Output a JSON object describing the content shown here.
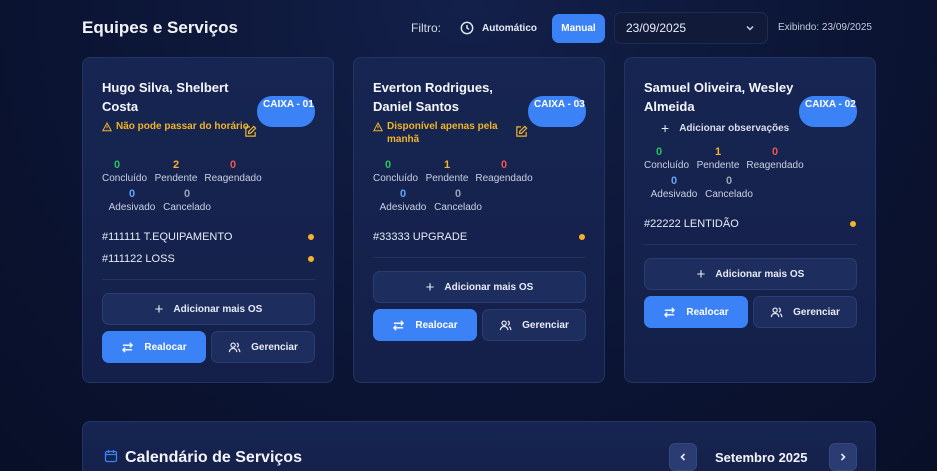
{
  "header": {
    "title": "Equipes e Serviços",
    "filter_label": "Filtro:",
    "auto_label": "Automático",
    "manual_label": "Manual",
    "date_value": "23/09/2025",
    "showing_text": "Exibindo: 23/09/2025"
  },
  "status_labels": {
    "concluido": "Concluído",
    "pendente": "Pendente",
    "reagendado": "Reagendado",
    "adesivado": "Adesivado",
    "cancelado": "Cancelado"
  },
  "actions": {
    "add_os": "Adicionar mais OS",
    "realocar": "Realocar",
    "gerenciar": "Gerenciar",
    "add_obs": "Adicionar observações"
  },
  "teams": [
    {
      "names": "Hugo Silva, Shelbert Costa",
      "badge": "CAIXA - 01",
      "note": "Não pode passar do horário",
      "stats": {
        "concluido": "0",
        "pendente": "2",
        "reagendado": "0",
        "adesivado": "0",
        "cancelado": "0"
      },
      "orders": [
        "#111111 T.EQUIPAMENTO",
        "#111122 LOSS"
      ]
    },
    {
      "names": "Everton Rodrigues, Daniel Santos",
      "badge": "CAIXA - 03",
      "note": "Disponível apenas pela manhã",
      "stats": {
        "concluido": "0",
        "pendente": "1",
        "reagendado": "0",
        "adesivado": "0",
        "cancelado": "0"
      },
      "orders": [
        "#33333 UPGRADE"
      ]
    },
    {
      "names": "Samuel Oliveira, Wesley Almeida",
      "badge": "CAIXA - 02",
      "note": "",
      "stats": {
        "concluido": "0",
        "pendente": "1",
        "reagendado": "0",
        "adesivado": "0",
        "cancelado": "0"
      },
      "orders": [
        "#22222 LENTIDÃO"
      ]
    }
  ],
  "calendar": {
    "title": "Calendário de Serviços",
    "month": "Setembro 2025"
  },
  "colors": {
    "accent": "#3b82f6",
    "warning": "#f0b429",
    "concluido": "#22c55e",
    "pendente": "#f5b32a",
    "reagendado": "#ef5350",
    "adesivado": "#60a5fa",
    "cancelado": "#9aa3b8"
  }
}
